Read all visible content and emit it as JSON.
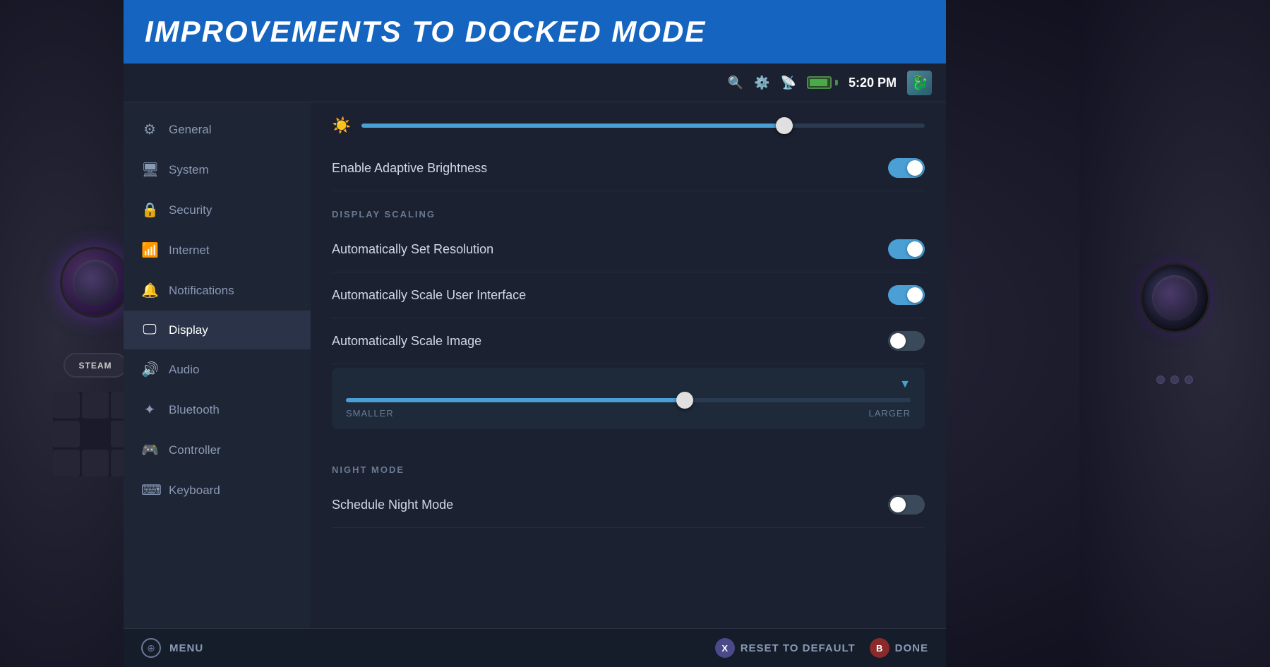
{
  "banner": {
    "title": "IMPROVEMENTS TO DOCKED MODE"
  },
  "statusBar": {
    "time": "5:20 PM",
    "searchIcon": "🔍",
    "settingsIcon": "⚙",
    "castIcon": "📡"
  },
  "sidebar": {
    "items": [
      {
        "id": "general",
        "label": "General",
        "icon": "⚙"
      },
      {
        "id": "system",
        "label": "System",
        "icon": "🖥"
      },
      {
        "id": "security",
        "label": "Security",
        "icon": "🔒"
      },
      {
        "id": "internet",
        "label": "Internet",
        "icon": "📶"
      },
      {
        "id": "notifications",
        "label": "Notifications",
        "icon": "🔔"
      },
      {
        "id": "display",
        "label": "Display",
        "icon": "🖵",
        "active": true
      },
      {
        "id": "audio",
        "label": "Audio",
        "icon": "🔊"
      },
      {
        "id": "bluetooth",
        "label": "Bluetooth",
        "icon": "🦷"
      },
      {
        "id": "controller",
        "label": "Controller",
        "icon": "🎮"
      },
      {
        "id": "keyboard",
        "label": "Keyboard",
        "icon": "⌨"
      }
    ]
  },
  "settings": {
    "brightnessSection": {
      "label": "Brightness",
      "sliderValue": 75
    },
    "adaptiveBrightness": {
      "label": "Enable Adaptive Brightness",
      "enabled": true
    },
    "displayScaling": {
      "sectionTitle": "DISPLAY SCALING",
      "autoResolution": {
        "label": "Automatically Set Resolution",
        "enabled": true
      },
      "autoScaleUI": {
        "label": "Automatically Scale User Interface",
        "enabled": true
      },
      "autoScaleImage": {
        "label": "Automatically Scale Image",
        "enabled": false
      },
      "scaleSlider": {
        "value": 60,
        "smallerLabel": "SMALLER",
        "largerLabel": "LARGER"
      }
    },
    "nightMode": {
      "sectionTitle": "NIGHT MODE",
      "scheduleNightMode": {
        "label": "Schedule Night Mode",
        "enabled": false
      }
    }
  },
  "bottomBar": {
    "menuIcon": "xbox",
    "menuLabel": "MENU",
    "resetButton": {
      "label": "RESET TO DEFAULT",
      "icon": "X"
    },
    "doneButton": {
      "label": "DONE",
      "icon": "B"
    }
  }
}
